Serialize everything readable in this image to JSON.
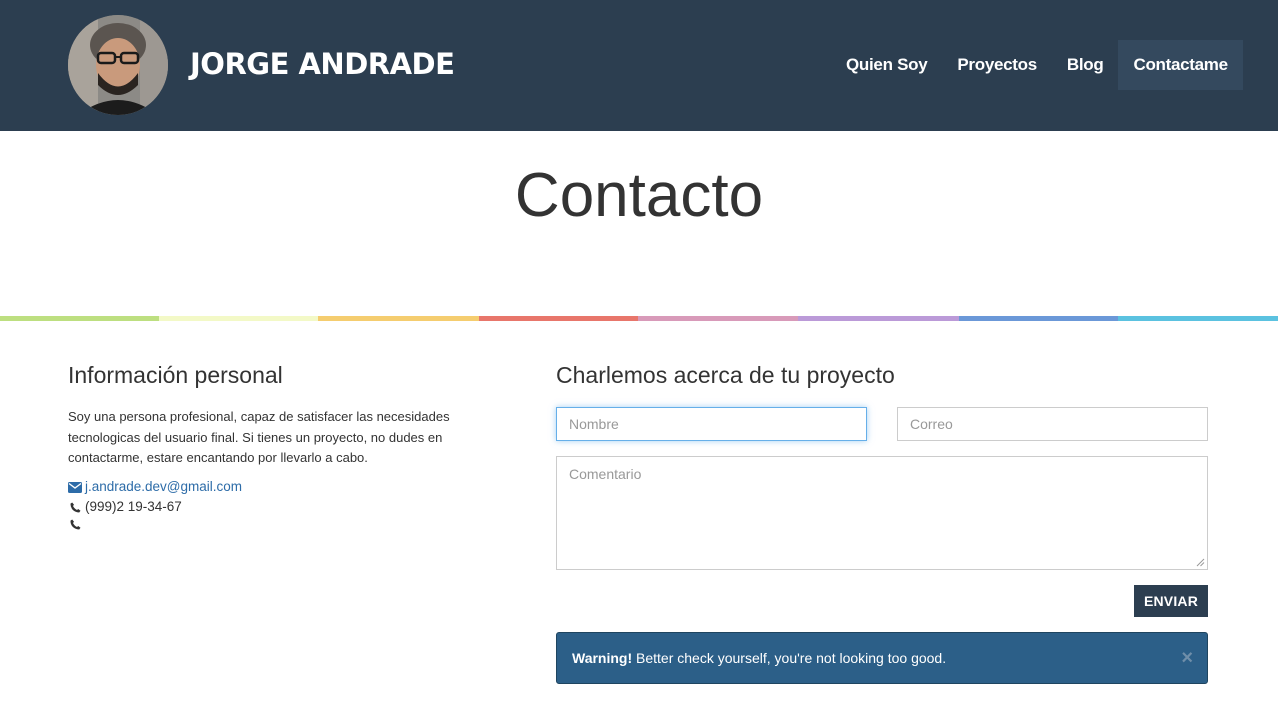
{
  "header": {
    "brand": "JORGE ANDRADE",
    "nav": [
      {
        "label": "Quien Soy"
      },
      {
        "label": "Proyectos"
      },
      {
        "label": "Blog"
      },
      {
        "label": "Contactame",
        "active": true
      }
    ]
  },
  "page": {
    "title": "Contacto"
  },
  "stripe_colors": [
    "#bddf80",
    "#f3f9c7",
    "#f5cd6f",
    "#e8766b",
    "#d89ab9",
    "#bb9ad8",
    "#6b98d8",
    "#5bc2e0"
  ],
  "info": {
    "heading": "Información personal",
    "text": "Soy una persona profesional, capaz de satisfacer las necesidades tecnologicas del usuario final. Si tienes un proyecto, no dudes en contactarme, estare encantando por llevarlo a cabo.",
    "email": "j.andrade.dev@gmail.com",
    "phone": "(999)2 19-34-67",
    "phone2": ""
  },
  "form": {
    "heading": "Charlemos acerca de tu proyecto",
    "name_placeholder": "Nombre",
    "email_placeholder": "Correo",
    "comment_placeholder": "Comentario",
    "submit_label": "ENVIAR"
  },
  "alert": {
    "title": "Warning!",
    "message": " Better check yourself, you're not looking too good.",
    "close": "×"
  },
  "colors": {
    "navbar": "#2c3e50",
    "link": "#2d6ca8",
    "alert": "#2c5f88"
  }
}
